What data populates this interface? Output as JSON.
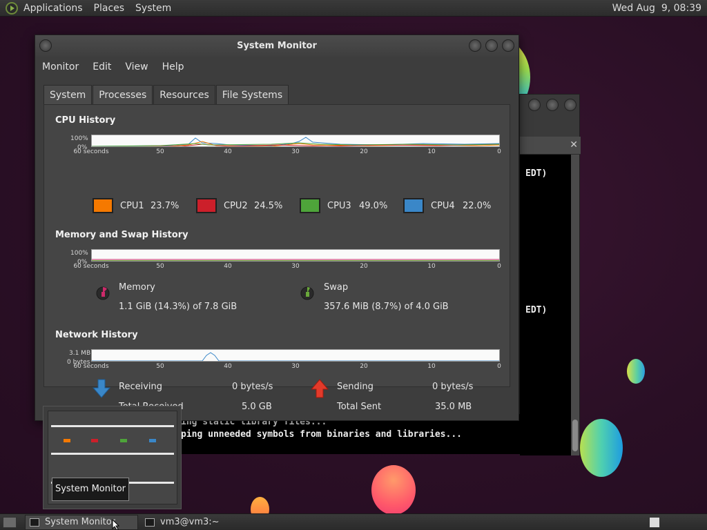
{
  "top_panel": {
    "menus": [
      "Applications",
      "Places",
      "System"
    ],
    "clock": "Wed Aug  9, 08:39"
  },
  "terminal": {
    "line1": "EDT)",
    "line2": "EDT)",
    "line3": "ing static library files...",
    "line4": "ping unneeded symbols from binaries and libraries..."
  },
  "sysmon": {
    "title": "System Monitor",
    "menu": [
      "Monitor",
      "Edit",
      "View",
      "Help"
    ],
    "tabs": [
      "System",
      "Processes",
      "Resources",
      "File Systems"
    ],
    "active_tab": "Resources",
    "cpu": {
      "title": "CPU History",
      "y_top": "100%",
      "y_bottom": "0%",
      "x_ticks": [
        "60 seconds",
        "50",
        "40",
        "30",
        "20",
        "10",
        "0"
      ],
      "cores": [
        {
          "label": "CPU1",
          "value": "23.7%",
          "color": "#f57900"
        },
        {
          "label": "CPU2",
          "value": "24.5%",
          "color": "#cc1f2a"
        },
        {
          "label": "CPU3",
          "value": "49.0%",
          "color": "#4ea43a"
        },
        {
          "label": "CPU4",
          "value": "22.0%",
          "color": "#3a87c8"
        }
      ]
    },
    "memory": {
      "title": "Memory and Swap History",
      "y_top": "100%",
      "y_bottom": "0%",
      "x_ticks": [
        "60 seconds",
        "50",
        "40",
        "30",
        "20",
        "10",
        "0"
      ],
      "memory_label": "Memory",
      "memory_value": "1.1 GiB (14.3%) of 7.8 GiB",
      "swap_label": "Swap",
      "swap_value": "357.6 MiB (8.7%) of 4.0 GiB",
      "memory_color": "#cc2a6a",
      "swap_color": "#6aa83a"
    },
    "network": {
      "title": "Network History",
      "y_top": "3.1 MB",
      "y_bottom": "0 bytes",
      "x_ticks": [
        "60 seconds",
        "50",
        "40",
        "30",
        "20",
        "10",
        "0"
      ],
      "receiving_label": "Receiving",
      "receiving_value": "0 bytes/s",
      "total_received_label": "Total Received",
      "total_received_value": "5.0 GB",
      "sending_label": "Sending",
      "sending_value": "0 bytes/s",
      "total_sent_label": "Total Sent",
      "total_sent_value": "35.0 MB"
    }
  },
  "tooltip": "System Monitor",
  "taskbar": {
    "tasks": [
      "System Monitor",
      "vm3@vm3:~"
    ]
  }
}
